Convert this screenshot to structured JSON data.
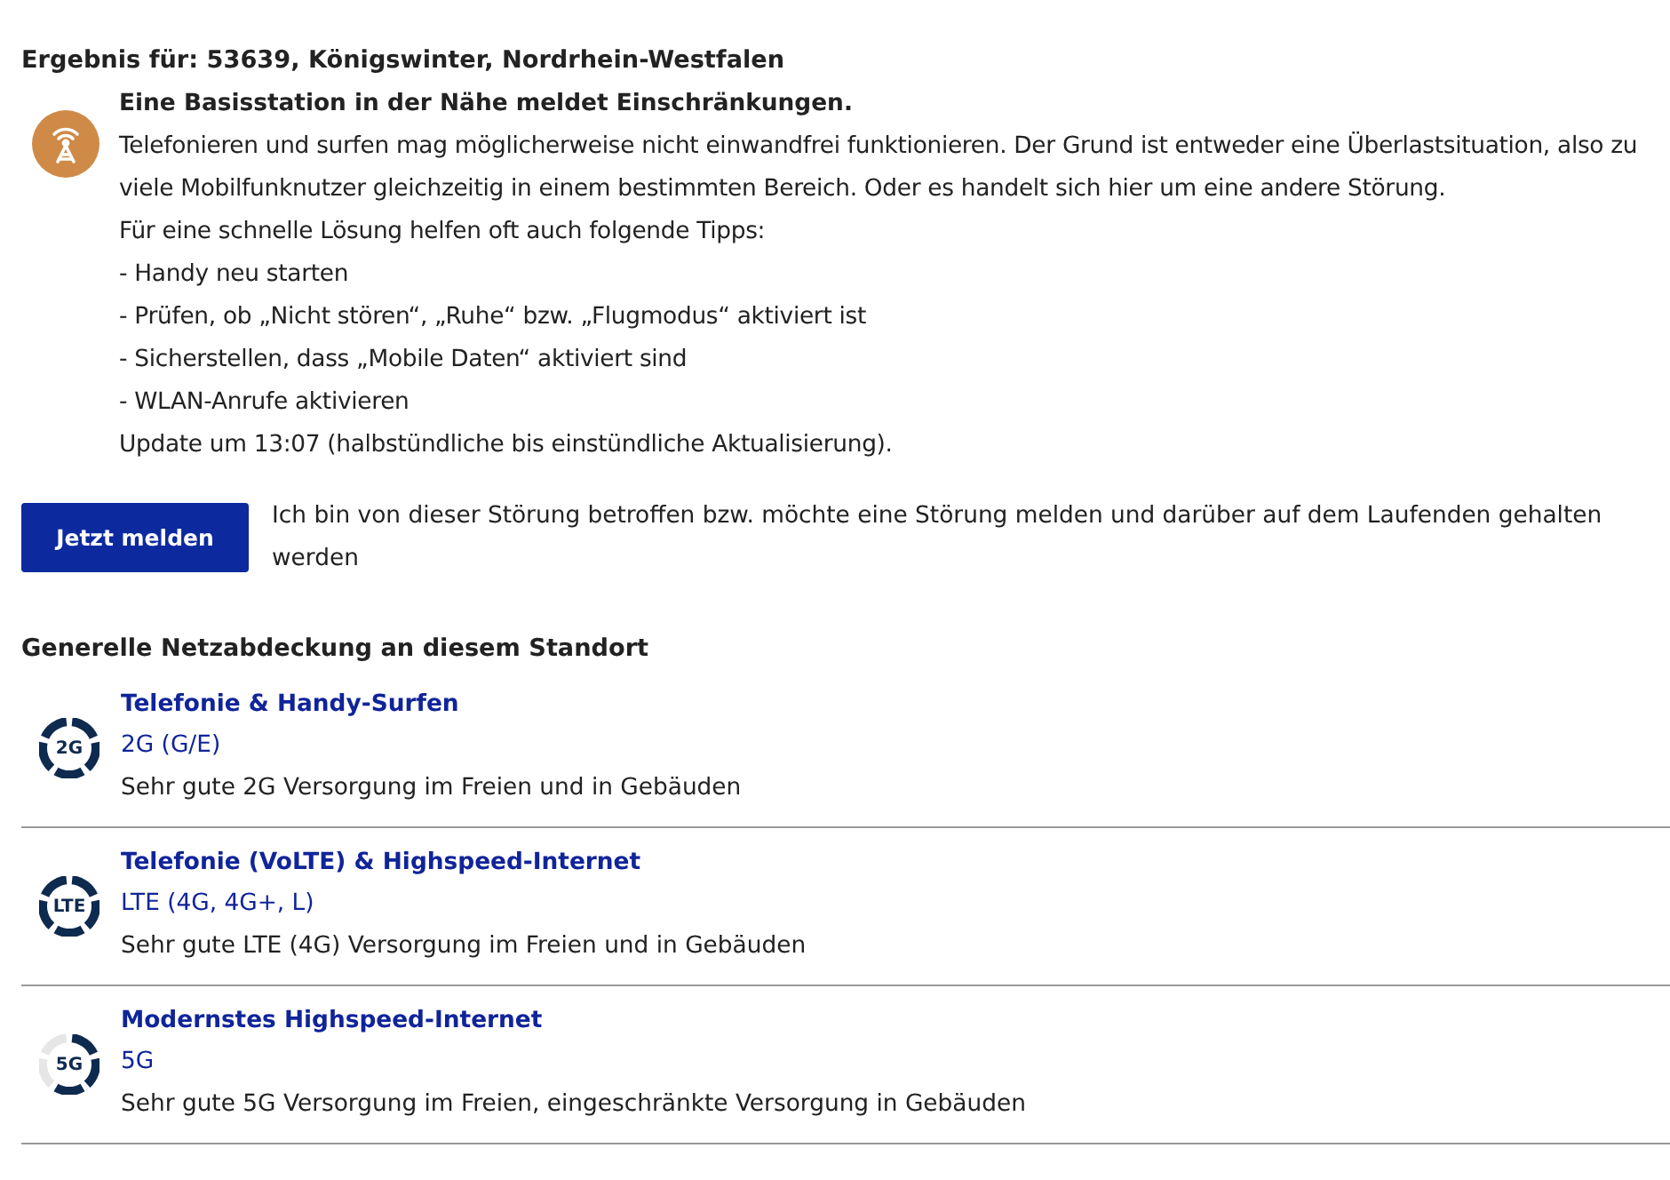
{
  "result_heading": "Ergebnis für: 53639, Königswinter, Nordrhein-Westfalen",
  "notice": {
    "title": "Eine Basisstation in der Nähe meldet Einschränkungen.",
    "lines": [
      "Telefonieren und surfen mag möglicherweise nicht einwandfrei funktionieren. Der Grund ist entweder eine Überlastsituation, also zu viele Mobilfunknutzer gleichzeitig in einem bestimmten Bereich. Oder es handelt sich hier um eine andere Störung.",
      "Für eine schnelle Lösung helfen oft auch folgende Tipps:",
      "- Handy neu starten",
      "- Prüfen, ob „Nicht stören“, „Ruhe“ bzw. „Flugmodus“ aktiviert ist",
      "- Sicherstellen, dass „Mobile Daten“ aktiviert sind",
      "- WLAN-Anrufe aktivieren"
    ],
    "update": "Update um 13:07 (halbstündliche bis einstündliche Aktualisierung)."
  },
  "report": {
    "button": "Jetzt melden",
    "text": "Ich bin von dieser Störung betroffen bzw. möchte eine Störung melden und darüber auf dem Laufenden gehalten werden"
  },
  "coverage_heading": "Generelle Netzabdeckung an diesem Standort",
  "coverage": [
    {
      "badge": "2G",
      "title": "Telefonie & Handy-Surfen",
      "tech": "2G (G/E)",
      "description": "Sehr gute 2G Versorgung im Freien und in Gebäuden",
      "kind": "full"
    },
    {
      "badge": "LTE",
      "title": "Telefonie (VoLTE) & Highspeed-Internet",
      "tech": "LTE (4G, 4G+, L)",
      "description": "Sehr gute LTE (4G) Versorgung im Freien und in Gebäuden",
      "kind": "full"
    },
    {
      "badge": "5G",
      "title": "Modernstes Highspeed-Internet",
      "tech": "5G",
      "description": "Sehr gute 5G Versorgung im Freien, eingeschränkte Versorgung in Gebäuden",
      "kind": "partial"
    }
  ]
}
